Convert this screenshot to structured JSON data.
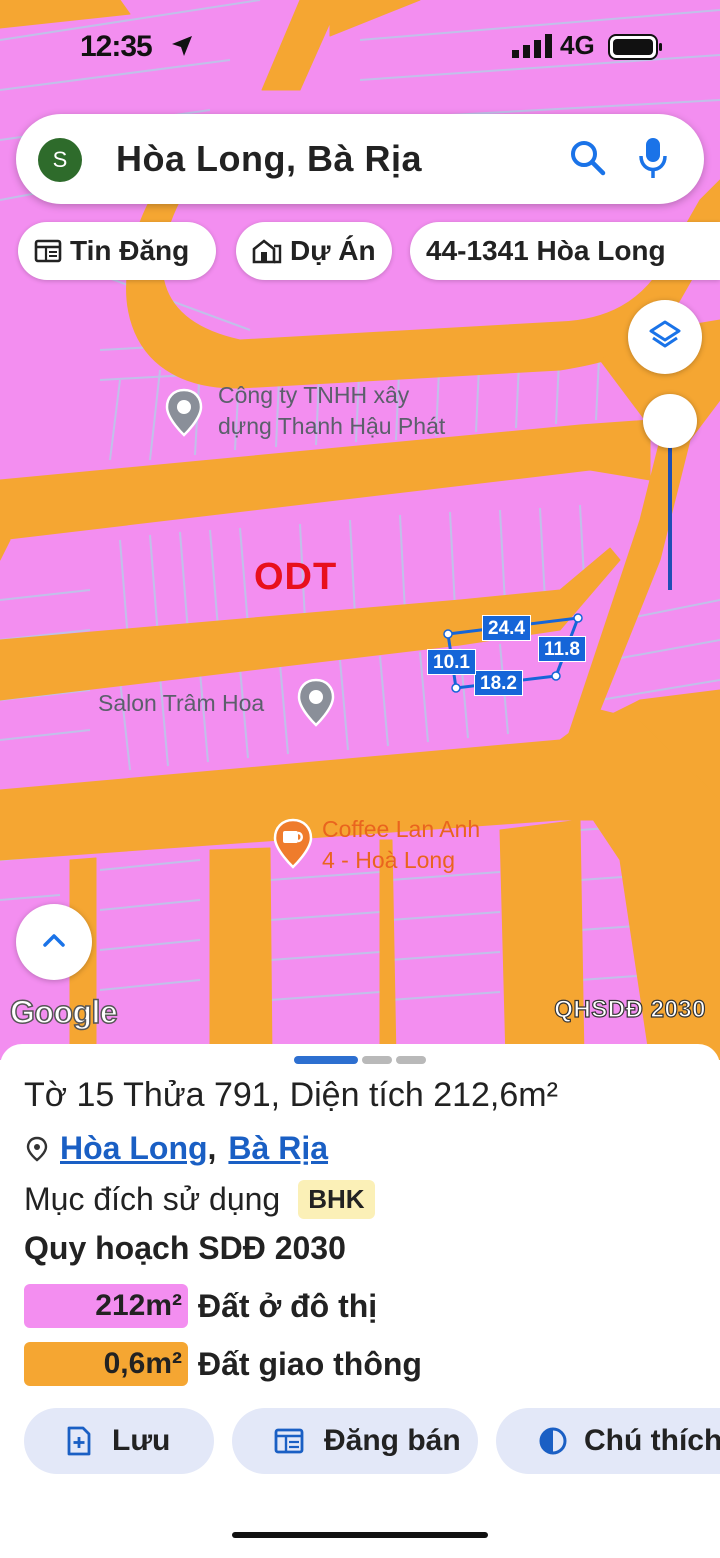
{
  "status_bar": {
    "time": "12:35",
    "network": "4G"
  },
  "search": {
    "avatar_letter": "S",
    "query": "Hòa Long, Bà Rịa"
  },
  "chips": [
    {
      "label": "Tin Đăng",
      "icon": "newspaper-icon"
    },
    {
      "label": "Dự Án",
      "icon": "building-icon"
    },
    {
      "label": "44-1341 Hòa Long",
      "icon": ""
    }
  ],
  "map": {
    "zone_code": "ODT",
    "pois": [
      {
        "name_line1": "Công ty TNHH xây",
        "name_line2": "dựng Thanh Hậu Phát",
        "icon": "location-pin-icon"
      },
      {
        "name_line1": "Salon Trâm Hoa",
        "name_line2": "",
        "icon": "location-pin-icon"
      },
      {
        "name_line1": "Coffee Lan Anh",
        "name_line2": "4 - Hoà Long",
        "icon": "coffee-icon"
      }
    ],
    "parcel_dimensions": {
      "top": "24.4",
      "right": "11.8",
      "bottom": "18.2",
      "left": "10.1"
    },
    "attribution": "Google",
    "layer_name": "QHSDĐ 2030",
    "colors": {
      "residential": "#f38ef0",
      "road": "#f5a632",
      "parcel_outline": "#1565d8",
      "zone_code": "#e8101d"
    }
  },
  "sheet": {
    "title": "Tờ 15 Thửa 791, Diện tích 212,6m²",
    "location": {
      "ward": "Hòa Long",
      "separator": ",",
      "city": "Bà Rịa"
    },
    "purpose_label": "Mục đích sử dụng",
    "purpose_code": "BHK",
    "plan_title": "Quy hoạch SDĐ 2030",
    "legend": [
      {
        "area": "212m²",
        "label": "Đất ở đô thị",
        "color": "#f38ef0"
      },
      {
        "area": "0,6m²",
        "label": "Đất giao thông",
        "color": "#f5a632"
      }
    ],
    "actions": [
      {
        "label": "Lưu",
        "icon": "bookmark-add-icon"
      },
      {
        "label": "Đăng bán",
        "icon": "listing-icon"
      },
      {
        "label": "Chú thích",
        "icon": "legend-contrast-icon"
      }
    ]
  }
}
